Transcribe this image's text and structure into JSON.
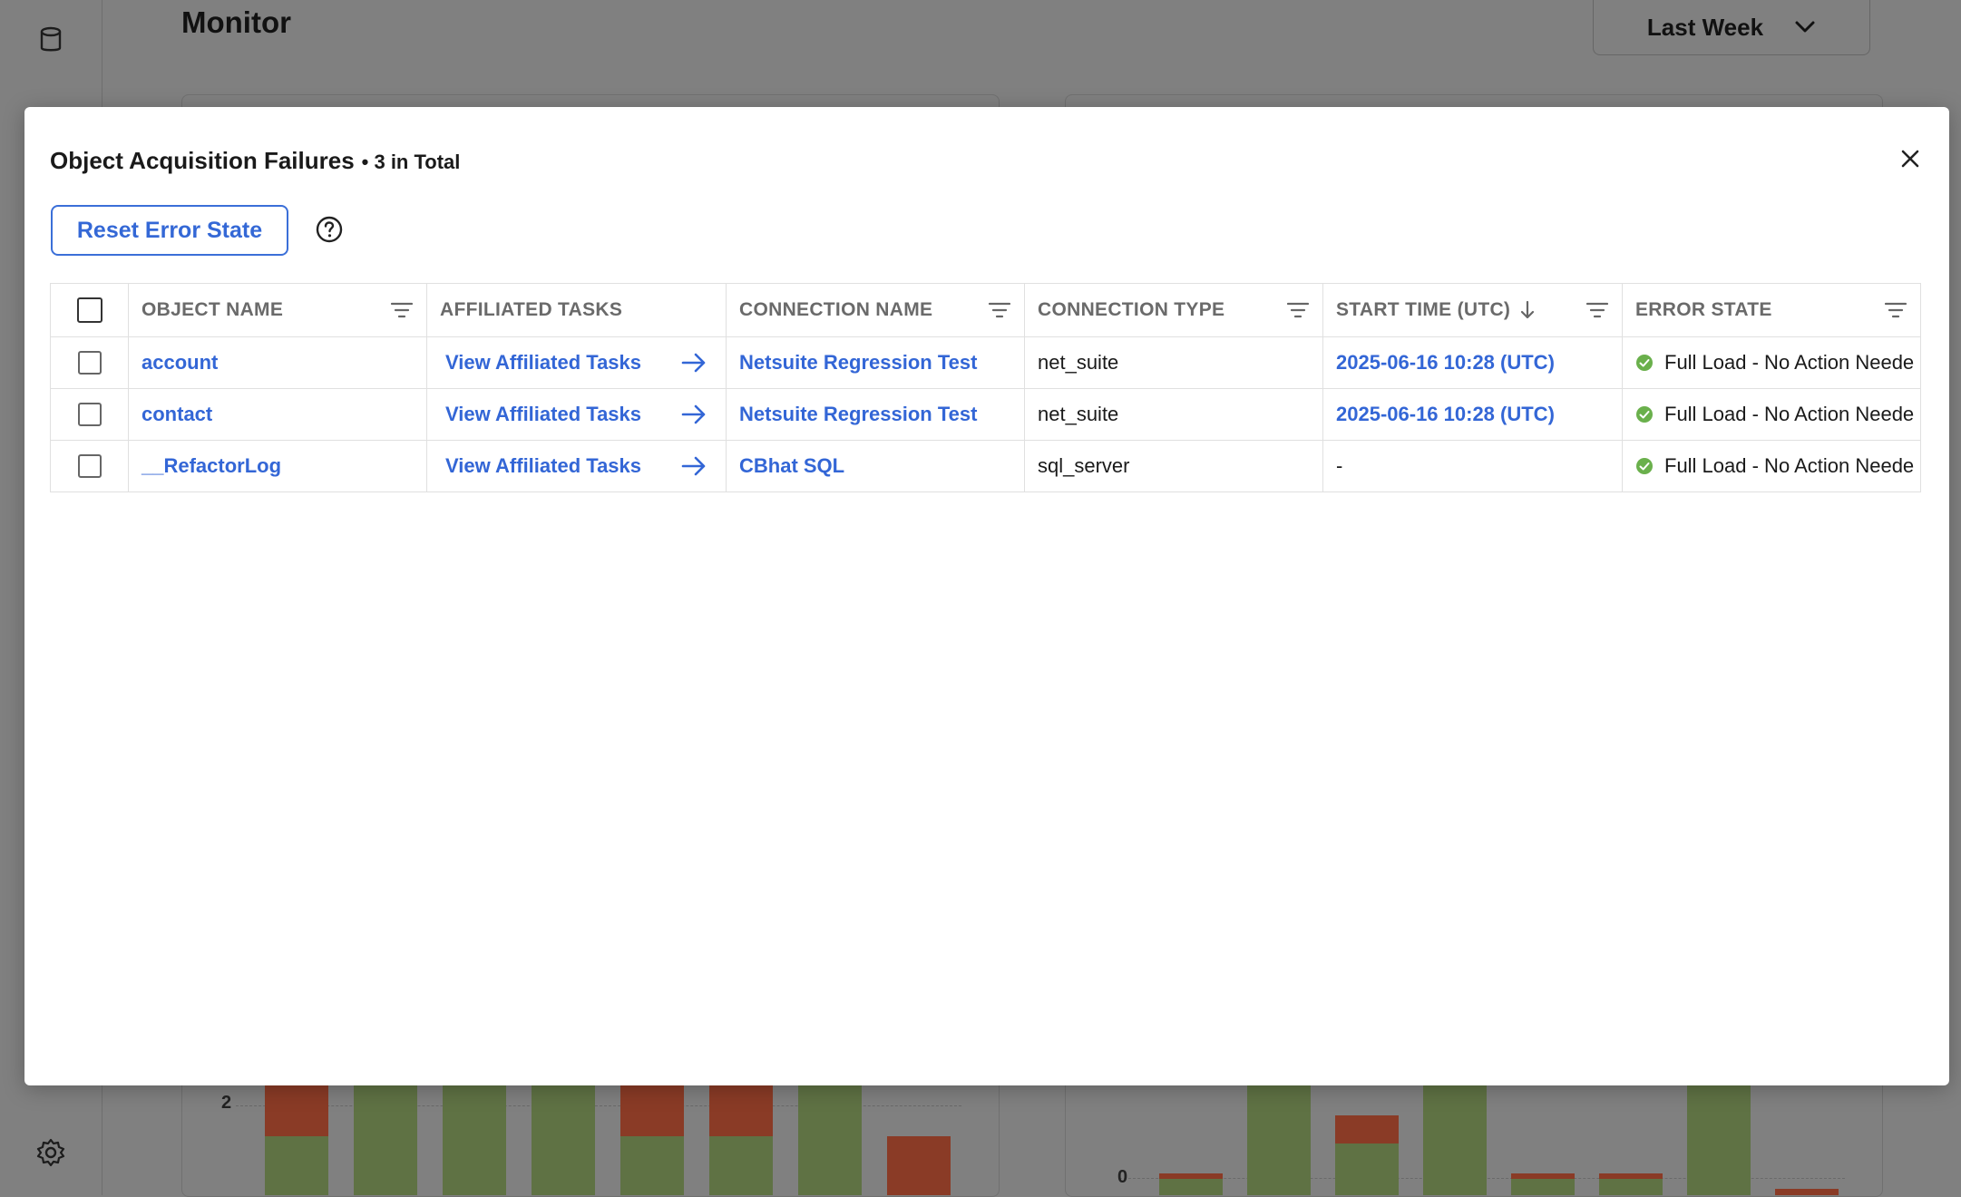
{
  "app": {
    "title": "Monitor",
    "range_select": {
      "value": "Last Week"
    },
    "charts": [
      {
        "y_tick_label": "2",
        "bars": [
          {
            "ok": 0.25,
            "err": 0.25
          },
          {
            "ok": 1.0,
            "err": 0.0
          },
          {
            "ok": 1.0,
            "err": 0.0
          },
          {
            "ok": 1.0,
            "err": 0.0
          },
          {
            "ok": 0.25,
            "err": 0.25
          },
          {
            "ok": 0.25,
            "err": 0.25
          },
          {
            "ok": 1.0,
            "err": 0.0
          },
          {
            "ok": 0.0,
            "err": 0.25
          }
        ]
      },
      {
        "y_tick_label": "0",
        "bars": [
          {
            "ok": 0.08,
            "err": 0.03
          },
          {
            "ok": 0.75,
            "err": 0.2
          },
          {
            "ok": 0.26,
            "err": 0.14
          },
          {
            "ok": 1.0,
            "err": 0.0
          },
          {
            "ok": 0.08,
            "err": 0.03
          },
          {
            "ok": 0.08,
            "err": 0.03
          },
          {
            "ok": 1.0,
            "err": 0.0
          },
          {
            "ok": 0.0,
            "err": 0.03
          }
        ]
      }
    ]
  },
  "modal": {
    "title": "Object Acquisition Failures",
    "subtitle": "• 3 in Total",
    "reset_button": "Reset Error State",
    "columns": [
      {
        "label": "OBJECT NAME"
      },
      {
        "label": "AFFILIATED TASKS"
      },
      {
        "label": "CONNECTION NAME"
      },
      {
        "label": "CONNECTION TYPE"
      },
      {
        "label": "START TIME (UTC)"
      },
      {
        "label": "ERROR STATE"
      }
    ],
    "rows": [
      {
        "object_name": "account",
        "affiliated_tasks": "View Affiliated Tasks",
        "connection_name": "Netsuite Regression Test",
        "connection_type": "net_suite",
        "start_time": "2025-06-16 10:28 (UTC)",
        "error_state": "Full Load - No Action Neede"
      },
      {
        "object_name": "contact",
        "affiliated_tasks": "View Affiliated Tasks",
        "connection_name": "Netsuite Regression Test",
        "connection_type": "net_suite",
        "start_time": "2025-06-16 10:28 (UTC)",
        "error_state": "Full Load - No Action Neede"
      },
      {
        "object_name": "__RefactorLog",
        "affiliated_tasks": "View Affiliated Tasks",
        "connection_name": "CBhat SQL",
        "connection_type": "sql_server",
        "start_time": "-",
        "error_state": "Full Load - No Action Neede"
      }
    ]
  },
  "colors": {
    "accent": "#3366d6",
    "ok_green": "#6ab04c",
    "bar_ok": "#5f7244",
    "bar_err": "#8a3b26"
  }
}
